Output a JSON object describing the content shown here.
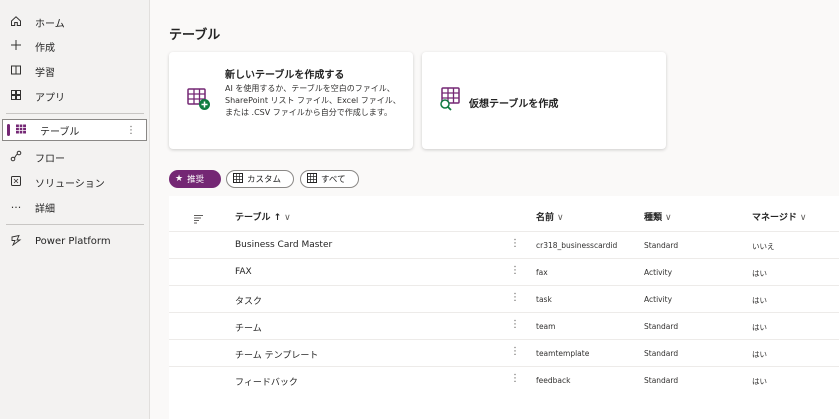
{
  "sidebar": {
    "items": [
      {
        "label": "ホーム",
        "icon": "home-icon"
      },
      {
        "label": "作成",
        "icon": "plus-icon"
      },
      {
        "label": "学習",
        "icon": "book-icon"
      },
      {
        "label": "アプリ",
        "icon": "apps-icon"
      },
      {
        "label": "テーブル",
        "icon": "table-icon",
        "more": "⋮"
      },
      {
        "label": "フロー",
        "icon": "flow-icon"
      },
      {
        "label": "ソリューション",
        "icon": "solution-icon"
      },
      {
        "label": "詳細",
        "icon": "more-icon",
        "glyph": "···"
      },
      {
        "label": "Power Platform",
        "icon": "power-platform-icon"
      }
    ]
  },
  "main": {
    "title": "テーブル",
    "cards": [
      {
        "title": "新しいテーブルを作成する",
        "description": "AI を使用するか、テーブルを空白のファイル、SharePoint リスト ファイル、Excel ファイル、または .CSV ファイルから自分で作成します。",
        "icon": "new-table-icon"
      },
      {
        "title": "仮想テーブルを作成",
        "icon": "virtual-table-icon"
      }
    ],
    "filters": [
      {
        "label": "推奨",
        "icon": "star-icon"
      },
      {
        "label": "カスタム",
        "icon": "custom-table-icon"
      },
      {
        "label": "すべて",
        "icon": "grid-icon"
      }
    ],
    "table": {
      "headers": {
        "name": "テーブル ↑",
        "logical": "名前",
        "type": "種類",
        "managed": "マネージド"
      },
      "chevron": "∨",
      "row_menu": "⋮",
      "rows": [
        {
          "name": "Business Card Master",
          "logical": "cr318_businesscardid",
          "type": "Standard",
          "managed": "いいえ"
        },
        {
          "name": "FAX",
          "logical": "fax",
          "type": "Activity",
          "managed": "はい"
        },
        {
          "name": "タスク",
          "logical": "task",
          "type": "Activity",
          "managed": "はい"
        },
        {
          "name": "チーム",
          "logical": "team",
          "type": "Standard",
          "managed": "はい"
        },
        {
          "name": "チーム テンプレート",
          "logical": "teamtemplate",
          "type": "Standard",
          "managed": "はい"
        },
        {
          "name": "フィードバック",
          "logical": "feedback",
          "type": "Standard",
          "managed": "はい"
        }
      ]
    }
  },
  "colors": {
    "accent": "#742774",
    "icon_green": "#107c41"
  }
}
